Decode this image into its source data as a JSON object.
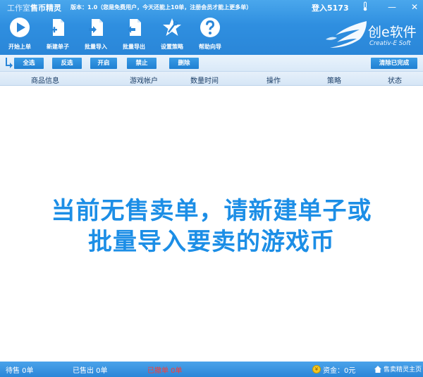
{
  "title_bar": {
    "app_title_part1": "工作室",
    "app_title_part2": "售币精灵",
    "version_text": "版本：1.0（您是免费用户，今天还能上10单，注册会员才能上更多单）",
    "login_label": "登入5173",
    "thermometer_icon": "thermometer-icon",
    "minimize_label": "—",
    "close_label": "✕"
  },
  "toolbar": {
    "items": [
      {
        "label": "开始上单",
        "icon": "play-icon"
      },
      {
        "label": "新建单子",
        "icon": "new-document-icon"
      },
      {
        "label": "批量导入",
        "icon": "import-icon"
      },
      {
        "label": "批量导出",
        "icon": "export-icon"
      },
      {
        "label": "设置策略",
        "icon": "settings-star-icon"
      },
      {
        "label": "帮助向导",
        "icon": "help-icon"
      }
    ]
  },
  "brand": {
    "name": "创e软件",
    "subtitle": "Creativ-E Soft"
  },
  "actions": {
    "select_all": "全选",
    "invert": "反选",
    "enable": "开启",
    "disable": "禁止",
    "delete": "删除",
    "clear_done": "清除已完成"
  },
  "columns": {
    "product": "商品信息",
    "account": "游戏帐户",
    "qty_time": "数量时间",
    "operation": "操作",
    "strategy": "策略",
    "status": "状态"
  },
  "empty_message": {
    "line1": "当前无售卖单，请新建单子或",
    "line2": "批量导入要卖的游戏币"
  },
  "status_bar": {
    "pending": "待售  0单",
    "sold": "已售出  0单",
    "cancelled": "已撤单  0单",
    "funds": "资金：0元",
    "home_link": "售卖精灵主页"
  },
  "colors": {
    "header_blue": "#2f8fe0",
    "message_blue": "#1c8ee6",
    "cancel_red": "#ff3b30"
  }
}
